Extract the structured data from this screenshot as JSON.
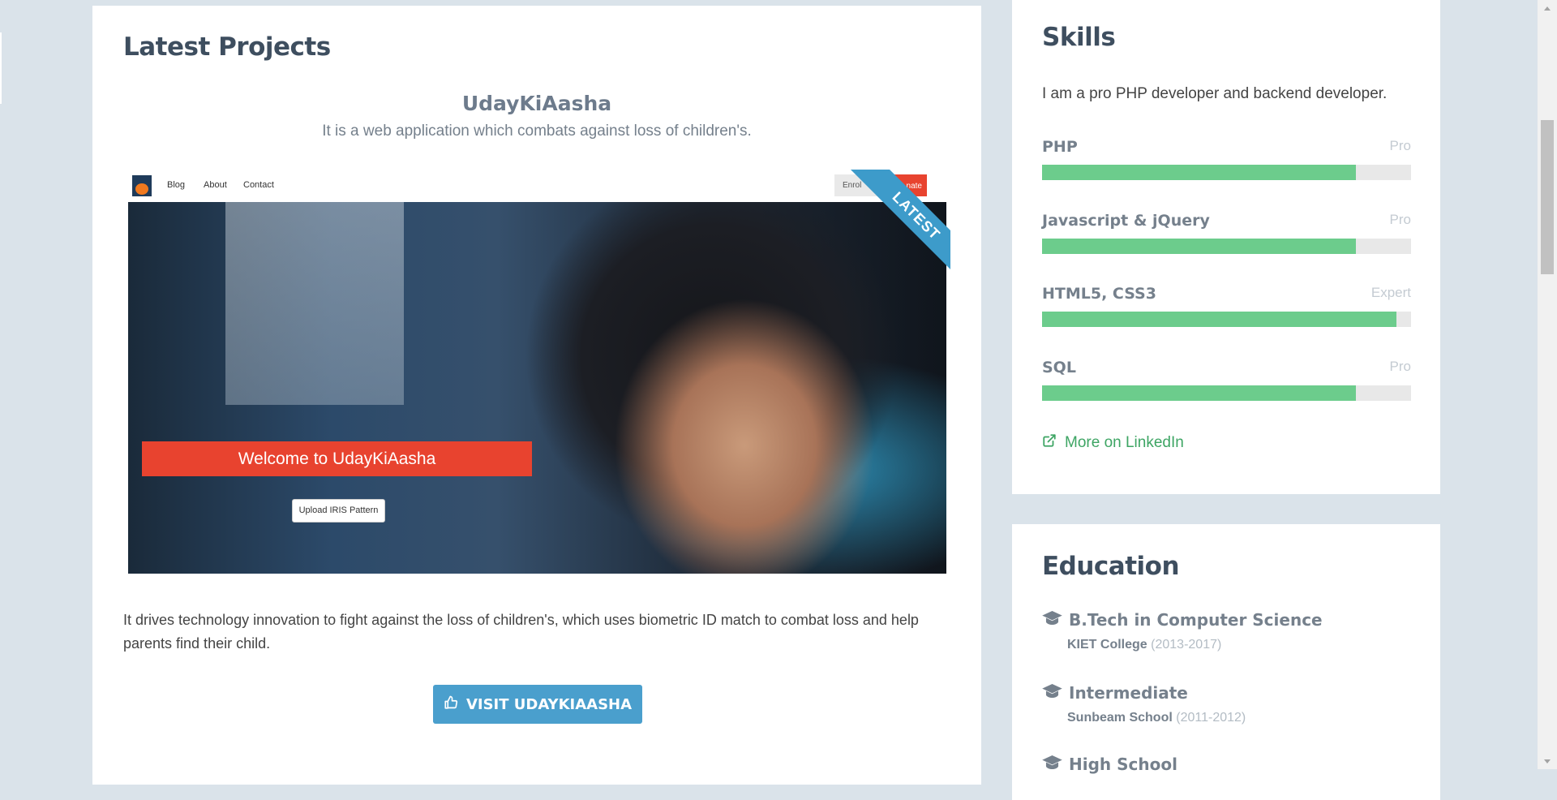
{
  "projects": {
    "section_title": "Latest Projects",
    "project_name": "UdayKiAasha",
    "tagline": "It is a web application which combats against loss of children's.",
    "ribbon": "LATEST",
    "screenshot": {
      "nav_links": [
        "Blog",
        "About",
        "Contact"
      ],
      "enroll_label": "Enrol",
      "donate_label": "nate",
      "welcome_text": "Welcome to UdayKiAasha",
      "upload_label": "Upload IRIS Pattern"
    },
    "description": "It drives technology innovation to fight against the loss of children's, which uses biometric ID match to combat loss and help parents find their child.",
    "visit_button": "VISIT UDAYKIAASHA"
  },
  "skills": {
    "section_title": "Skills",
    "intro": "I am a pro PHP developer and backend developer.",
    "items": [
      {
        "name": "PHP",
        "level": "Pro",
        "percent": 85
      },
      {
        "name": "Javascript & jQuery",
        "level": "Pro",
        "percent": 85
      },
      {
        "name": "HTML5, CSS3",
        "level": "Expert",
        "percent": 96
      },
      {
        "name": "SQL",
        "level": "Pro",
        "percent": 85
      }
    ],
    "linkedin_label": "More on LinkedIn"
  },
  "education": {
    "section_title": "Education",
    "items": [
      {
        "degree": "B.Tech in Computer Science",
        "school": "KIET College",
        "years": "(2013-2017)"
      },
      {
        "degree": "Intermediate",
        "school": "Sunbeam School",
        "years": "(2011-2012)"
      },
      {
        "degree": "High School",
        "school": "",
        "years": ""
      }
    ]
  },
  "colors": {
    "page_background": "#dae3ea",
    "accent_blue": "#4a9fcd",
    "skill_bar_green": "#6ccc8c",
    "link_green": "#3ea564",
    "banner_red": "#e8432f"
  },
  "icons": [
    "thumbs-up-icon",
    "external-link-icon",
    "graduation-cap-icon"
  ]
}
